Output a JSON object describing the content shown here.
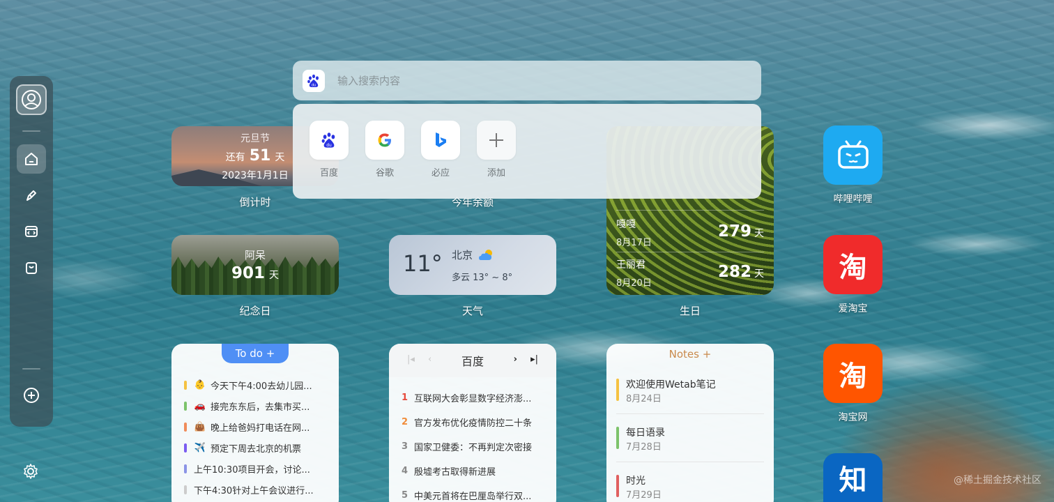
{
  "search": {
    "placeholder": "输入搜索内容",
    "engines": [
      {
        "name": "baidu",
        "label": "百度"
      },
      {
        "name": "google",
        "label": "谷歌"
      },
      {
        "name": "bing",
        "label": "必应"
      },
      {
        "name": "add",
        "label": "添加"
      }
    ]
  },
  "countdown": {
    "title": "元旦节",
    "prefix": "还有",
    "days": "51",
    "unit": "天",
    "date": "2023年1月1日",
    "caption": "倒计时"
  },
  "year_left": {
    "caption": "今年余额"
  },
  "anniversary": {
    "title": "阿呆",
    "days": "901",
    "unit": "天",
    "caption": "纪念日"
  },
  "weather": {
    "temp": "11°",
    "city": "北京",
    "condition": "多云 13° ~ 8°",
    "caption": "天气"
  },
  "birthday": {
    "caption": "生日",
    "items": [
      {
        "name": "嘎嘎",
        "date": "8月17日",
        "days": "279",
        "unit": "天"
      },
      {
        "name": "王丽君",
        "date": "8月20日",
        "days": "282",
        "unit": "天"
      }
    ]
  },
  "todo": {
    "tab": "To do +",
    "items": [
      {
        "emoji": "👶",
        "text": "今天下午4:00去幼儿园...",
        "color": "#f5c242"
      },
      {
        "emoji": "🚗",
        "text": "接完东东后，去集市买...",
        "color": "#7cc36b"
      },
      {
        "emoji": "👜",
        "text": "晚上给爸妈打电话在网...",
        "color": "#f08c5a"
      },
      {
        "emoji": "✈️",
        "text": "预定下周去北京的机票",
        "color": "#7a5cf0"
      },
      {
        "emoji": "",
        "text": "上午10:30项目开会，讨论...",
        "color": "#8b94e6"
      },
      {
        "emoji": "",
        "text": "下午4:30针对上午会议进行...",
        "color": "#cccccc"
      }
    ]
  },
  "news": {
    "title": "百度",
    "items": [
      {
        "rank": "1",
        "text": "互联网大会彰显数字经济澎...",
        "color": "#e64a3c"
      },
      {
        "rank": "2",
        "text": "官方发布优化疫情防控二十条",
        "color": "#f08c3a"
      },
      {
        "rank": "3",
        "text": "国家卫健委：不再判定次密接",
        "color": "#888888"
      },
      {
        "rank": "4",
        "text": "殷墟考古取得新进展",
        "color": "#888888"
      },
      {
        "rank": "5",
        "text": "中美元首将在巴厘岛举行双...",
        "color": "#888888"
      }
    ]
  },
  "notes": {
    "head": "Notes +",
    "items": [
      {
        "title": "欢迎使用Wetab笔记",
        "date": "8月24日",
        "color": "#f5c242"
      },
      {
        "title": "每日语录",
        "date": "7月28日",
        "color": "#7cc36b"
      },
      {
        "title": "时光",
        "date": "7月29日",
        "color": "#e06060"
      }
    ]
  },
  "apps": [
    {
      "name": "bilibili",
      "label": "哔哩哔哩",
      "color": "#1eaaf1"
    },
    {
      "name": "aitaobao",
      "label": "爱淘宝",
      "color": "#f02b2b",
      "char": "淘"
    },
    {
      "name": "taobao",
      "label": "淘宝网",
      "color": "#ff5500",
      "char": "淘"
    },
    {
      "name": "zhihu",
      "label": "",
      "color": "#0a66c2",
      "char": "知"
    }
  ],
  "watermark": "@稀土掘金技术社区"
}
